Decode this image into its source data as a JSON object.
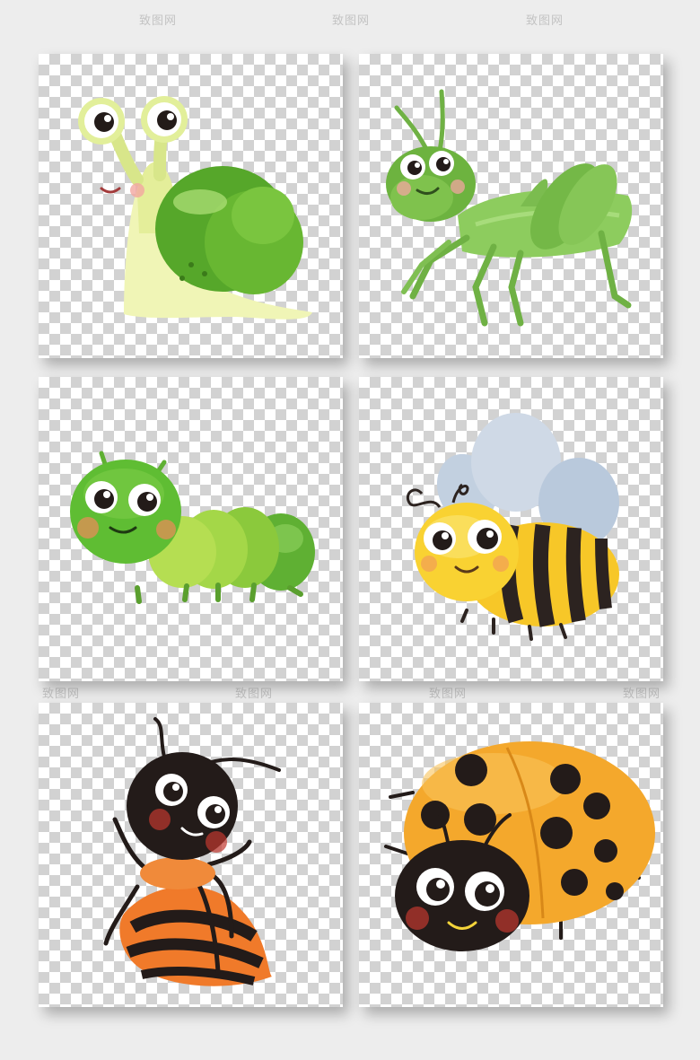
{
  "watermark": {
    "text": "致图网",
    "color": "#a0a0a0"
  },
  "tiles": [
    {
      "name": "snail",
      "icon": "snail-icon",
      "colors": {
        "shell": "#5cab2c",
        "body": "#eaf3a8"
      }
    },
    {
      "name": "grasshopper",
      "icon": "grasshopper-icon",
      "colors": {
        "body": "#8dcc5e"
      }
    },
    {
      "name": "caterpillar",
      "icon": "caterpillar-icon",
      "colors": {
        "head": "#5fbd33",
        "body": "#8fcf3b"
      }
    },
    {
      "name": "bee",
      "icon": "bee-icon",
      "colors": {
        "body": "#f7c728",
        "stripe": "#2c2320",
        "wing": "#b9c9dc"
      }
    },
    {
      "name": "ant",
      "icon": "ant-icon",
      "colors": {
        "head": "#231b19",
        "body": "#f07a2a"
      }
    },
    {
      "name": "ladybug",
      "icon": "ladybug-icon",
      "colors": {
        "shell": "#f4a82c",
        "spot": "#231b19"
      }
    }
  ]
}
